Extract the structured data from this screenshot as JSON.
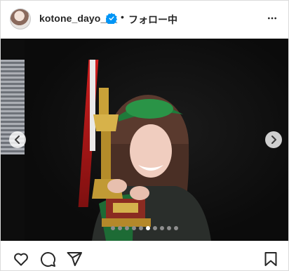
{
  "header": {
    "username": "kotone_dayo___",
    "separator": "•",
    "follow_label": "フォロー中",
    "avatar_icon": "profile-avatar",
    "verified_icon": "verified-badge-icon",
    "more_icon": "more-options-icon",
    "verified_color": "#0095f6"
  },
  "media": {
    "prev_icon": "chevron-left-icon",
    "next_icon": "chevron-right-icon",
    "carousel": {
      "total": 10,
      "active_index": 5
    }
  },
  "actions": {
    "like_icon": "heart-icon",
    "comment_icon": "comment-icon",
    "share_icon": "send-icon",
    "save_icon": "bookmark-icon"
  }
}
